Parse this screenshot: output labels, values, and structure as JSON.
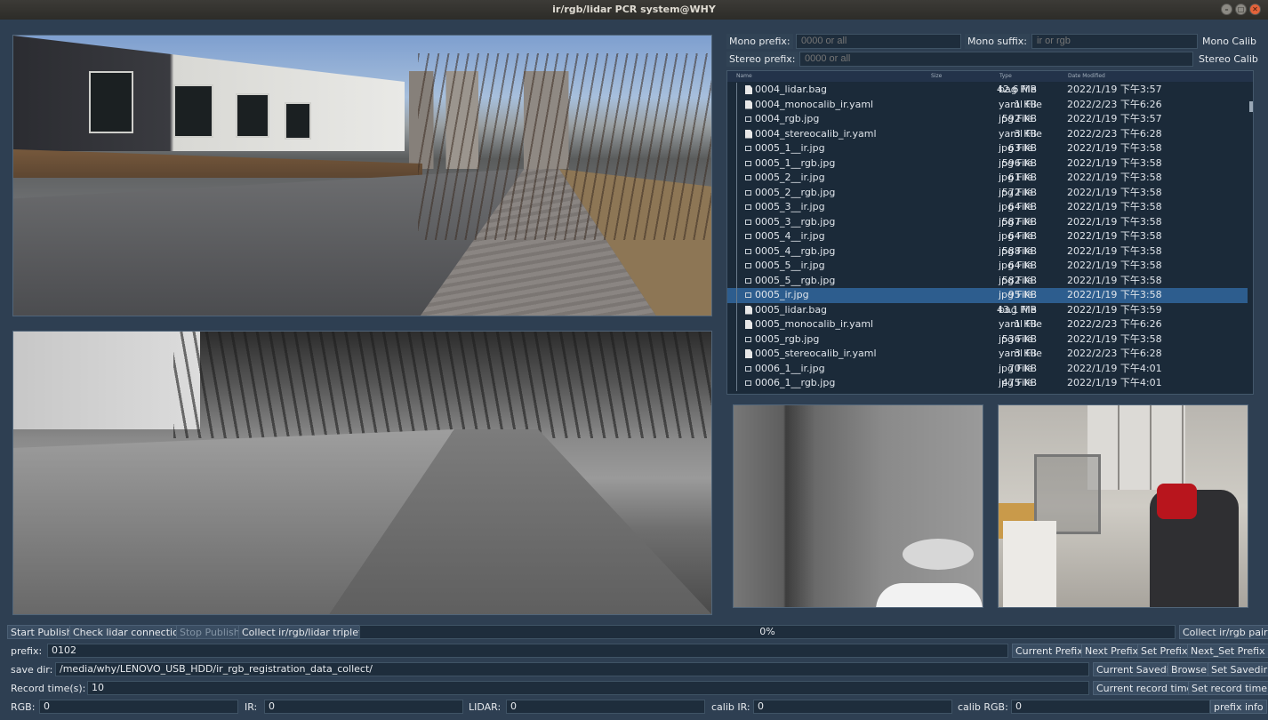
{
  "window": {
    "title": "ir/rgb/lidar PCR system@WHY"
  },
  "calib": {
    "mono_prefix_label": "Mono prefix:",
    "mono_prefix_placeholder": "0000 or all",
    "mono_suffix_label": "Mono suffix:",
    "mono_suffix_placeholder": "ir or rgb",
    "mono_calib_label": "Mono Calib",
    "stereo_prefix_label": "Stereo prefix:",
    "stereo_prefix_placeholder": "0000 or all",
    "stereo_calib_label": "Stereo Calib"
  },
  "file_browser": {
    "columns": [
      "Name",
      "Size",
      "Type",
      "Date Modified"
    ],
    "rows": [
      {
        "name": "0004_lidar.bag",
        "size": "42.6 MB",
        "type": "bag File",
        "date": "2022/1/19 下午3:57",
        "icon": "file-icon"
      },
      {
        "name": "0004_monocalib_ir.yaml",
        "size": "1 KB",
        "type": "yaml File",
        "date": "2022/2/23 下午6:26",
        "icon": "file-icon"
      },
      {
        "name": "0004_rgb.jpg",
        "size": "592 KB",
        "type": "jpg File",
        "date": "2022/1/19 下午3:57",
        "icon": "image-icon"
      },
      {
        "name": "0004_stereocalib_ir.yaml",
        "size": "3 KB",
        "type": "yaml File",
        "date": "2022/2/23 下午6:28",
        "icon": "file-icon"
      },
      {
        "name": "0005_1__ir.jpg",
        "size": "63 KB",
        "type": "jpg File",
        "date": "2022/1/19 下午3:58",
        "icon": "image-icon"
      },
      {
        "name": "0005_1__rgb.jpg",
        "size": "596 KB",
        "type": "jpg File",
        "date": "2022/1/19 下午3:58",
        "icon": "image-icon"
      },
      {
        "name": "0005_2__ir.jpg",
        "size": "61 KB",
        "type": "jpg File",
        "date": "2022/1/19 下午3:58",
        "icon": "image-icon"
      },
      {
        "name": "0005_2__rgb.jpg",
        "size": "572 KB",
        "type": "jpg File",
        "date": "2022/1/19 下午3:58",
        "icon": "image-icon"
      },
      {
        "name": "0005_3__ir.jpg",
        "size": "64 KB",
        "type": "jpg File",
        "date": "2022/1/19 下午3:58",
        "icon": "image-icon"
      },
      {
        "name": "0005_3__rgb.jpg",
        "size": "587 KB",
        "type": "jpg File",
        "date": "2022/1/19 下午3:58",
        "icon": "image-icon"
      },
      {
        "name": "0005_4__ir.jpg",
        "size": "64 KB",
        "type": "jpg File",
        "date": "2022/1/19 下午3:58",
        "icon": "image-icon"
      },
      {
        "name": "0005_4__rgb.jpg",
        "size": "588 KB",
        "type": "jpg File",
        "date": "2022/1/19 下午3:58",
        "icon": "image-icon"
      },
      {
        "name": "0005_5__ir.jpg",
        "size": "64 KB",
        "type": "jpg File",
        "date": "2022/1/19 下午3:58",
        "icon": "image-icon"
      },
      {
        "name": "0005_5__rgb.jpg",
        "size": "582 KB",
        "type": "jpg File",
        "date": "2022/1/19 下午3:58",
        "icon": "image-icon"
      },
      {
        "name": "0005_ir.jpg",
        "size": "95 KB",
        "type": "jpg File",
        "date": "2022/1/19 下午3:58",
        "icon": "image-icon",
        "selected": true
      },
      {
        "name": "0005_lidar.bag",
        "size": "43.1 MB",
        "type": "bag File",
        "date": "2022/1/19 下午3:59",
        "icon": "file-icon"
      },
      {
        "name": "0005_monocalib_ir.yaml",
        "size": "1 KB",
        "type": "yaml File",
        "date": "2022/2/23 下午6:26",
        "icon": "file-icon"
      },
      {
        "name": "0005_rgb.jpg",
        "size": "536 KB",
        "type": "jpg File",
        "date": "2022/1/19 下午3:58",
        "icon": "image-icon"
      },
      {
        "name": "0005_stereocalib_ir.yaml",
        "size": "3 KB",
        "type": "yaml File",
        "date": "2022/2/23 下午6:28",
        "icon": "file-icon"
      },
      {
        "name": "0006_1__ir.jpg",
        "size": "70 KB",
        "type": "jpg File",
        "date": "2022/1/19 下午4:01",
        "icon": "image-icon"
      },
      {
        "name": "0006_1__rgb.jpg",
        "size": "475 KB",
        "type": "jpg File",
        "date": "2022/1/19 下午4:01",
        "icon": "image-icon"
      }
    ]
  },
  "controls": {
    "start_publish": "Start Publish",
    "check_lidar": "Check lidar connection",
    "stop_publish": "Stop Publish",
    "collect_triplet": "Collect ir/rgb/lidar triplet",
    "progress_text": "0%",
    "progress_value": 0,
    "collect_pair": "Collect ir/rgb pair",
    "prefix_label": "prefix:",
    "prefix_value": "0102",
    "current_prefix": "Current Prefix",
    "next_prefix": "Next Prefix",
    "set_prefix": "Set Prefix",
    "next_set_prefix": "Next_Set Prefix",
    "savedir_label": "save dir:",
    "savedir_value": "/media/why/LENOVO_USB_HDD/ir_rgb_registration_data_collect/",
    "current_savedir": "Current Savedir",
    "browse": "Browse",
    "set_savedir": "Set Savedir",
    "record_label": "Record time(s):",
    "record_value": "10",
    "current_record": "Current record time",
    "set_record": "Set record time",
    "rgb_label": "RGB:",
    "rgb_value": "0",
    "ir_label": "IR:",
    "ir_value": "0",
    "lidar_label": "LIDAR:",
    "lidar_value": "0",
    "calib_ir_label": "calib IR:",
    "calib_ir_value": "0",
    "calib_rgb_label": "calib RGB:",
    "calib_rgb_value": "0",
    "prefix_info": "prefix info"
  }
}
